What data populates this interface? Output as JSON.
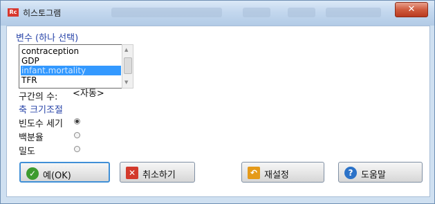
{
  "window": {
    "title": "히스토그램",
    "close_glyph": "✕"
  },
  "app_icon_text": "Rc",
  "variables": {
    "label": "변수 (하나 선택)",
    "items": [
      "contraception",
      "GDP",
      "infant.mortality",
      "TFR"
    ],
    "selected_index": 2
  },
  "bins": {
    "label": "구간의 수:",
    "value": "<자동>"
  },
  "scale": {
    "label": "축 크기조절"
  },
  "scale_options": [
    {
      "label": "빈도수 세기",
      "checked": true
    },
    {
      "label": "백분율",
      "checked": false
    },
    {
      "label": "밀도",
      "checked": false
    }
  ],
  "buttons": {
    "ok": "예(OK)",
    "cancel": "취소하기",
    "reset": "재설정",
    "help": "도움말"
  },
  "icons": {
    "ok": "check-circle-icon",
    "cancel": "x-square-icon",
    "reset": "undo-arrow-icon",
    "help": "question-circle-icon"
  }
}
